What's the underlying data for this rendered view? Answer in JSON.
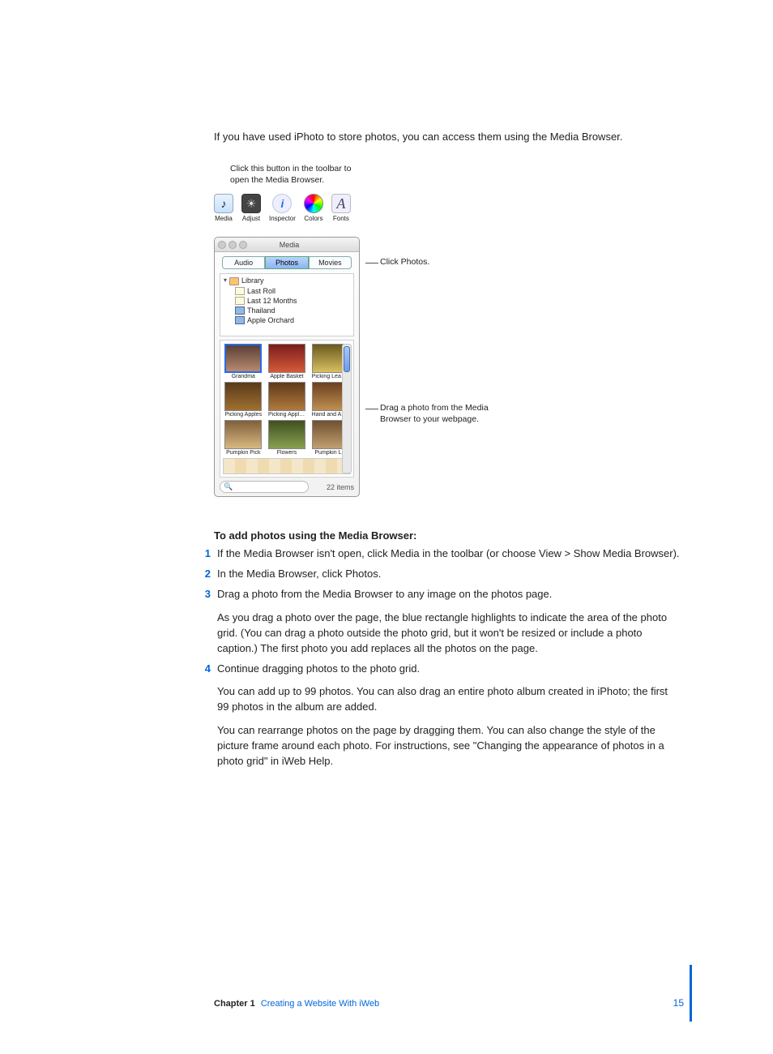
{
  "intro": "If you have used iPhoto to store photos, you can access them using the Media Browser.",
  "callouts": {
    "top": "Click this button in the toolbar to open the Media Browser.",
    "tabs": "Click Photos.",
    "drag": "Drag a photo from the Media Browser to your webpage."
  },
  "toolbar": {
    "items": [
      {
        "label": "Media"
      },
      {
        "label": "Adjust"
      },
      {
        "label": "Inspector"
      },
      {
        "label": "Colors"
      },
      {
        "label": "Fonts"
      }
    ]
  },
  "media_panel": {
    "title": "Media",
    "tabs": {
      "audio": "Audio",
      "photos": "Photos",
      "movies": "Movies"
    },
    "tree": {
      "library": "Library",
      "last_roll": "Last Roll",
      "last_12": "Last 12 Months",
      "thailand": "Thailand",
      "apple_orchard": "Apple Orchard"
    },
    "thumbs": [
      {
        "cap": "Grandma"
      },
      {
        "cap": "Apple Basket"
      },
      {
        "cap": "Picking Leaves"
      },
      {
        "cap": "Picking Apples"
      },
      {
        "cap": "Picking Apple…"
      },
      {
        "cap": "Hand and Ap…"
      },
      {
        "cap": "Pumpkin Pick"
      },
      {
        "cap": "Flowers"
      },
      {
        "cap": "Pumpkin Lift"
      }
    ],
    "count": "22 items"
  },
  "section": {
    "head": "To add photos using the Media Browser:"
  },
  "steps": {
    "s1": "If the Media Browser isn't open, click Media in the toolbar (or choose View > Show Media Browser).",
    "s2": "In the Media Browser, click Photos.",
    "s3": "Drag a photo from the Media Browser to any image on the photos page.",
    "s3b": "As you drag a photo over the page, the blue rectangle highlights to indicate the area of the photo grid. (You can drag a photo outside the photo grid, but it won't be resized or include a photo caption.) The first photo you add replaces all the photos on the page.",
    "s4": "Continue dragging photos to the photo grid.",
    "s4b": "You can add up to 99 photos. You can also drag an entire photo album created in iPhoto; the first 99 photos in the album are added.",
    "s4c": "You can rearrange photos on the page by dragging them. You can also change the style of the picture frame around each photo. For instructions, see \"Changing the appearance of photos in a photo grid\" in iWeb Help."
  },
  "footer": {
    "chapter": "Chapter 1",
    "name": "Creating a Website With iWeb",
    "page": "15"
  }
}
